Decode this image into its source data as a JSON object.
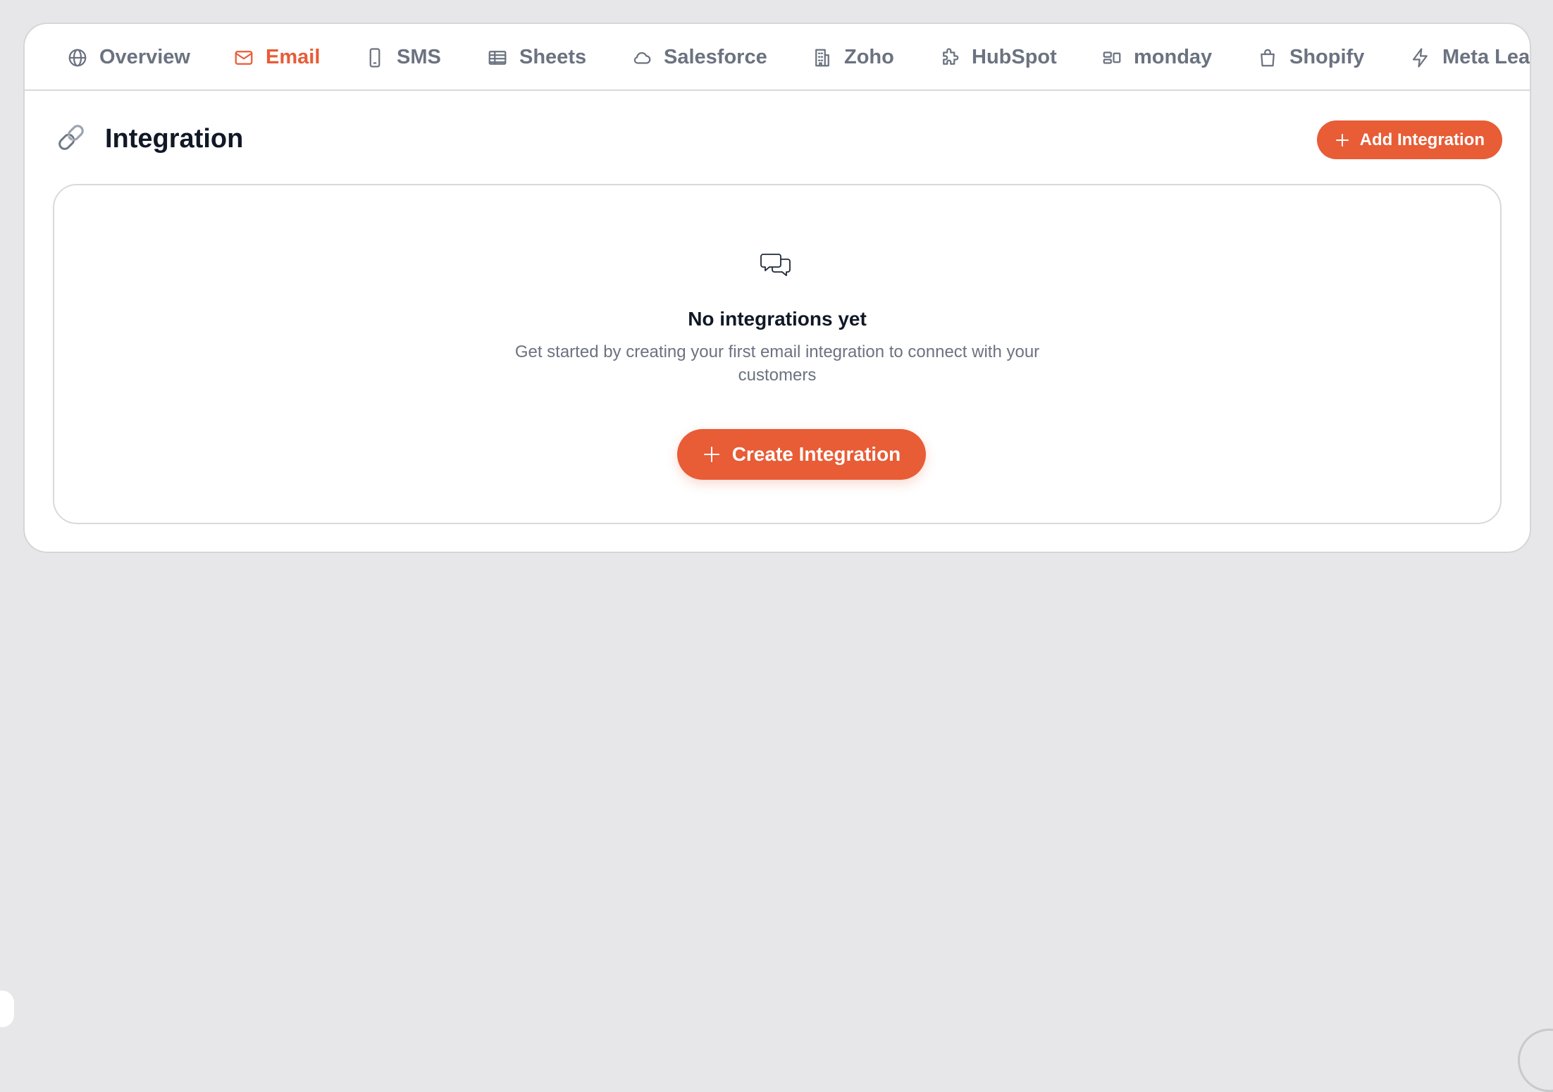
{
  "tabs": [
    {
      "label": "Overview",
      "icon": "globe-icon"
    },
    {
      "label": "Email",
      "icon": "mail-icon",
      "active": true
    },
    {
      "label": "SMS",
      "icon": "phone-icon"
    },
    {
      "label": "Sheets",
      "icon": "table-icon"
    },
    {
      "label": "Salesforce",
      "icon": "cloud-icon"
    },
    {
      "label": "Zoho",
      "icon": "building-icon"
    },
    {
      "label": "HubSpot",
      "icon": "puzzle-icon"
    },
    {
      "label": "monday",
      "icon": "board-icon"
    },
    {
      "label": "Shopify",
      "icon": "shopping-bag-icon"
    },
    {
      "label": "Meta Lea",
      "icon": "lightning-icon"
    }
  ],
  "header": {
    "title": "Integration",
    "icon": "link-icon",
    "add_button": "Add Integration"
  },
  "empty_state": {
    "icon": "chat-bubbles-icon",
    "heading": "No integrations yet",
    "description": "Get started by creating your first email integration to connect with your customers",
    "create_button": "Create Integration"
  },
  "colors": {
    "accent": "#e85c36",
    "background": "#e7e7ea",
    "text_primary": "#111827",
    "text_muted": "#6b7280"
  }
}
